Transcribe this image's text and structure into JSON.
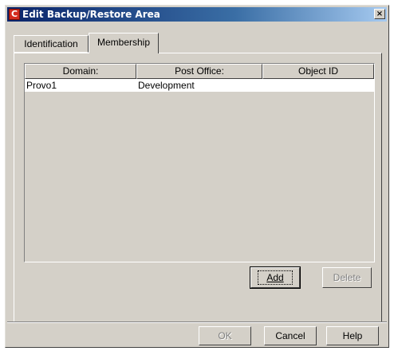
{
  "window": {
    "title": "Edit Backup/Restore Area",
    "close_glyph": "×",
    "icon": "app-icon",
    "icon_letter": "C"
  },
  "tabs": [
    {
      "label": "Identification",
      "selected": false
    },
    {
      "label": "Membership",
      "selected": true
    }
  ],
  "table": {
    "columns": [
      "Domain:",
      "Post Office:",
      "Object ID"
    ],
    "rows": [
      [
        "Provo1",
        "Development",
        ""
      ]
    ]
  },
  "membership_buttons": {
    "add_label": "Add",
    "delete_label": "Delete"
  },
  "dialog_buttons": {
    "ok_label": "OK",
    "cancel_label": "Cancel",
    "help_label": "Help"
  }
}
